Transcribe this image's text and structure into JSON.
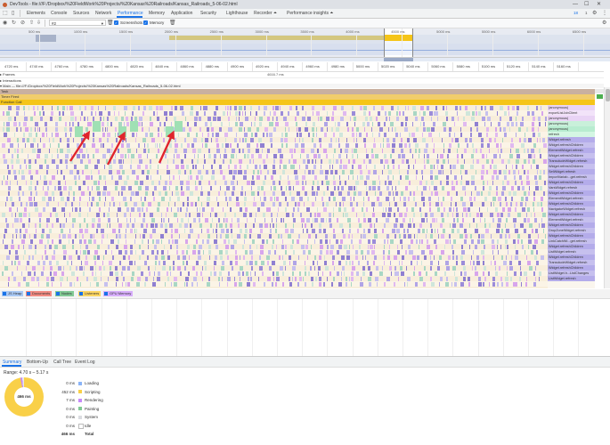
{
  "window": {
    "title": "DevTools - file:///F:/Dropbox/%20FieldWork%20Projects/%20Kansas%20Railroads/Kansas_Railroads_5-06-02.html"
  },
  "devtools_tabs": {
    "items": [
      "Elements",
      "Console",
      "Sources",
      "Network",
      "Performance",
      "Memory",
      "Application",
      "Security",
      "Lighthouse",
      "Recorder ⏶",
      "Performance insights ⏶"
    ],
    "active": "Performance",
    "issues_badge": "18",
    "message_badge": "1"
  },
  "toolbar": {
    "profile_select": "#2",
    "screenshots_label": "Screenshots",
    "memory_label": "Memory"
  },
  "overview": {
    "labels": [
      "500 ms",
      "1000 ms",
      "1500 ms",
      "2000 ms",
      "2500 ms",
      "3000 ms",
      "3500 ms",
      "4000 ms",
      "4500 ms",
      "5000 ms",
      "5500 ms",
      "6000 ms",
      "6500 ms",
      "7000 ms"
    ]
  },
  "ruler": {
    "labels": [
      "4720 ms",
      "4740 ms",
      "4760 ms",
      "4780 ms",
      "4800 ms",
      "4820 ms",
      "4840 ms",
      "4860 ms",
      "4880 ms",
      "4900 ms",
      "4920 ms",
      "4940 ms",
      "4960 ms",
      "4980 ms",
      "5000 ms",
      "5020 ms",
      "5040 ms",
      "5060 ms",
      "5080 ms",
      "5100 ms",
      "5120 ms",
      "5140 ms",
      "5160 ms"
    ]
  },
  "sections": {
    "frames": "▸ Frames",
    "frames_value": "4616.7 ms",
    "interactions": "▸ Interactions",
    "main": "▾ Main — file:///F:/Dropbox/%20FieldWork%20Projects/%20Kansas%20Railroads/Kansas_Railroads_5-06-02.html"
  },
  "flame": {
    "top_rows": [
      "Task",
      "Timer Fired",
      "Function Call"
    ],
    "function_labels": [
      "(anonymous)",
      "exportListJobClient",
      "(anonymous)",
      "(anonymous)",
      "(anonymous)",
      "refresh",
      "Widget.refresh",
      "Widget.refreshChildren",
      "ElementWidget.refresh",
      "Widget.refreshChildren",
      "TranscludeWidget.refresh",
      "Widget.refreshChildren",
      "SetWidget.refresh",
      "ImportVariab...get.refresh",
      "Widget.refreshChildren",
      "VarsWidget.refresh",
      "Widget.refreshChildren",
      "ElementWidget.refresh",
      "Widget.refreshChildren",
      "NavigatorWidget.refresh",
      "Widget.refreshChildren",
      "ElementWidget.refresh",
      "Widget.refreshChildren",
      "DropZoneWidget.refresh",
      "Widget.refreshChildren",
      "LinkCatchWi...get.refresh",
      "Widget.refreshChildren",
      "ListWidget.refresh",
      "Widget.refreshChildren",
      "TranscludeWidget.refresh",
      "Widget.refreshChildren",
      "ListWidget.h...ListChanges",
      "ListWidget.refresh"
    ]
  },
  "tracks": [
    {
      "label": "JS Heap",
      "color": "#a8c8f4"
    },
    {
      "label": "Documents",
      "color": "#f28b82"
    },
    {
      "label": "Nodes",
      "color": "#81c995"
    },
    {
      "label": "Listeners",
      "color": "#fdd663"
    },
    {
      "label": "GPU Memory",
      "color": "#d7aefb"
    }
  ],
  "summary_tabs": {
    "items": [
      "Summary",
      "Bottom-Up",
      "Call Tree",
      "Event Log"
    ],
    "active": "Summary"
  },
  "summary": {
    "range": "Range: 4.70 s – 5.17 s",
    "total_center": "466 ms",
    "rows": [
      {
        "ms": "0 ms",
        "label": "Loading",
        "color": "#8ab4f8",
        "value": 0
      },
      {
        "ms": "452 ms",
        "label": "Scripting",
        "color": "#f9d048",
        "value": 452
      },
      {
        "ms": "7 ms",
        "label": "Rendering",
        "color": "#c58af9",
        "value": 7
      },
      {
        "ms": "0 ms",
        "label": "Painting",
        "color": "#81c995",
        "value": 0
      },
      {
        "ms": "0 ms",
        "label": "System",
        "color": "#dadce0",
        "value": 0
      },
      {
        "ms": "0 ms",
        "label": "Idle",
        "color": "#ffffff",
        "value": 0
      },
      {
        "ms": "466 ms",
        "label": "Total",
        "color": "",
        "value": 466
      }
    ]
  },
  "colors": {
    "task": "#c9b0a0",
    "timer_fired": "#f1cd6c",
    "function_call": "#f5c518",
    "annotation_arrow": "#e0242c"
  }
}
